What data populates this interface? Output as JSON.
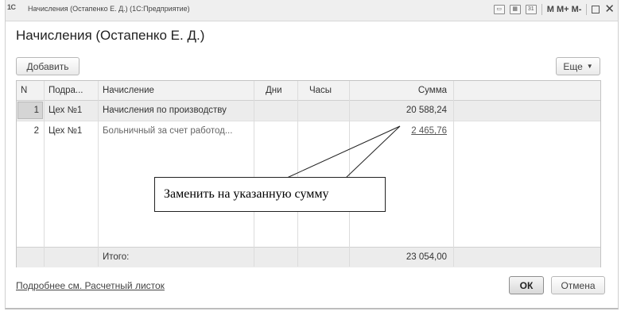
{
  "window": {
    "title": "Начисления (Остапенко Е. Д.)  (1С:Предприятие)",
    "logo": "1С",
    "toolbar_text": "M  M+  M-"
  },
  "form": {
    "heading": "Начисления (Остапенко Е. Д.)",
    "add_label": "Добавить",
    "more_label": "Еще"
  },
  "table": {
    "columns": [
      "N",
      "Подра...",
      "Начисление",
      "Дни",
      "Часы",
      "Сумма"
    ],
    "rows": [
      {
        "n": "1",
        "dept": "Цех №1",
        "accrual": "Начисления по производству",
        "days": "",
        "hours": "",
        "sum": "20 588,24"
      },
      {
        "n": "2",
        "dept": "Цех №1",
        "accrual": "Больничный за счет работод...",
        "days": "",
        "hours": "",
        "sum": "2 465,76"
      }
    ],
    "footer": {
      "label": "Итого:",
      "sum": "23 054,00"
    }
  },
  "callout": {
    "text": "Заменить на указанную сумму"
  },
  "bottom": {
    "link": "Подробнее см. Расчетный листок",
    "ok_label": "ОК",
    "cancel_label": "Отмена"
  }
}
